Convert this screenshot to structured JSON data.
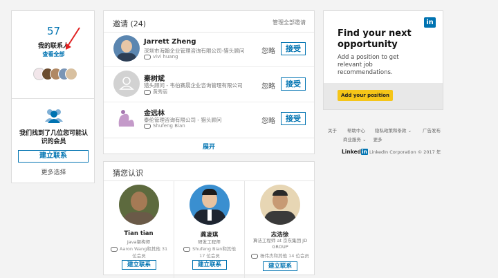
{
  "left": {
    "count": "57",
    "title": "我的联系人",
    "view_all": "查看全部",
    "found_text_1": "我们找到了几位您可能认",
    "found_text_2": "识的会员",
    "build_btn": "建立联系",
    "more": "更多选择"
  },
  "invites": {
    "title": "邀请 (24)",
    "manage": "管理全部邀请",
    "expand": "展开",
    "items": [
      {
        "name": "Jarrett Zheng",
        "subtitle": "深圳市海翰企业管理咨询有限公司-猎头顾问",
        "mutual": "vivi huang",
        "ignore": "忽略",
        "accept": "接受"
      },
      {
        "name": "秦树斌",
        "subtitle": "猎头顾问 - 韦伯赛晨企业咨询管理有限公司",
        "mutual": "黄秀丽",
        "ignore": "忽略",
        "accept": "接受"
      },
      {
        "name": "金远林",
        "subtitle": "泰伦管理咨询有限公司 - 猎头顾问",
        "mutual": "Shufeng Bian",
        "ignore": "忽略",
        "accept": "接受"
      }
    ]
  },
  "pymk": {
    "title": "猜您认识",
    "people": [
      {
        "name": "Tian tian",
        "title": "Java架构师",
        "mutual": "Aaron Wang和其他 31 位会员",
        "button": "建立联系"
      },
      {
        "name": "龚凌琪",
        "title": "研发工程师",
        "mutual": "Shufeng Bian和其他 17 位会员",
        "button": "建立联系"
      },
      {
        "name": "志浩徐",
        "title": "算法工程师 at 京东集团 JD GROUP",
        "mutual": "杨伟杰和其他 14 位会员",
        "button": "建立联系"
      }
    ]
  },
  "ad": {
    "logo": "in",
    "headline_1": "Find your next",
    "headline_2": "opportunity",
    "body": "Add a position to get relevant job recommendations.",
    "button": "Add your position"
  },
  "footer": {
    "links_row1": [
      "关于",
      "帮助中心",
      "隐私政策和条款",
      "广告发布"
    ],
    "links_row2": [
      "商业服务",
      "更多"
    ],
    "brand": "Linked",
    "brand_in": "in",
    "copyright": "LinkedIn Corporation © 2017 年"
  },
  "colors": {
    "linkedin_blue": "#0073b1",
    "ad_button": "#f5c518",
    "annotation": "#e02020"
  }
}
